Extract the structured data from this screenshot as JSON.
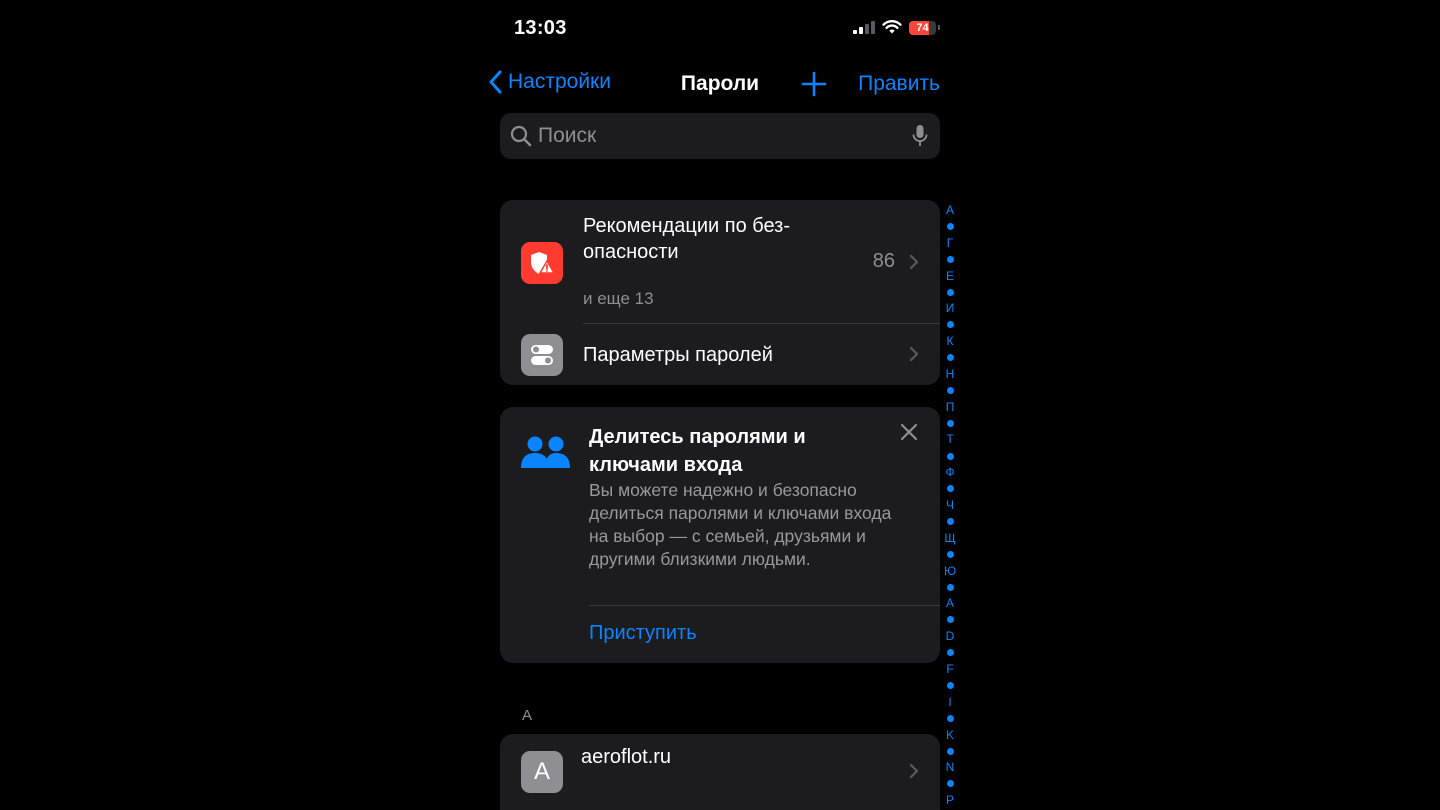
{
  "status_bar": {
    "time": "13:03",
    "battery_level": "74",
    "battery_fraction": 0.74,
    "battery_color": "#ff453a"
  },
  "nav": {
    "back_label": "Настройки",
    "title": "Пароли",
    "edit_label": "Править"
  },
  "search": {
    "placeholder": "Поиск"
  },
  "security": {
    "title": "Рекомендации по без-опасности",
    "count": "86",
    "subtitle": "и еще 13",
    "icon_color": "#ff3b30"
  },
  "options": {
    "title": "Параметры паролей"
  },
  "share": {
    "title": "Делитесь паролями и ключами входа",
    "description": "Вы можете надежно и безопасно делиться паролями и ключами входа на выбор — с семьей, друзьями и другими близкими людьми.",
    "action": "Приступить"
  },
  "list": {
    "section_header": "A",
    "items": [
      {
        "letter": "A",
        "title": "aeroflot.ru"
      }
    ]
  },
  "index": [
    "А",
    "•",
    "Г",
    "•",
    "Е",
    "•",
    "И",
    "•",
    "К",
    "•",
    "Н",
    "•",
    "П",
    "•",
    "Т",
    "•",
    "Ф",
    "•",
    "Ч",
    "•",
    "Щ",
    "•",
    "Ю",
    "•",
    "A",
    "•",
    "D",
    "•",
    "F",
    "•",
    "I",
    "•",
    "K",
    "•",
    "N",
    "•",
    "P"
  ],
  "colors": {
    "accent": "#0a84ff",
    "card_bg": "#1c1c1e",
    "secondary_text": "#8e8e93"
  }
}
